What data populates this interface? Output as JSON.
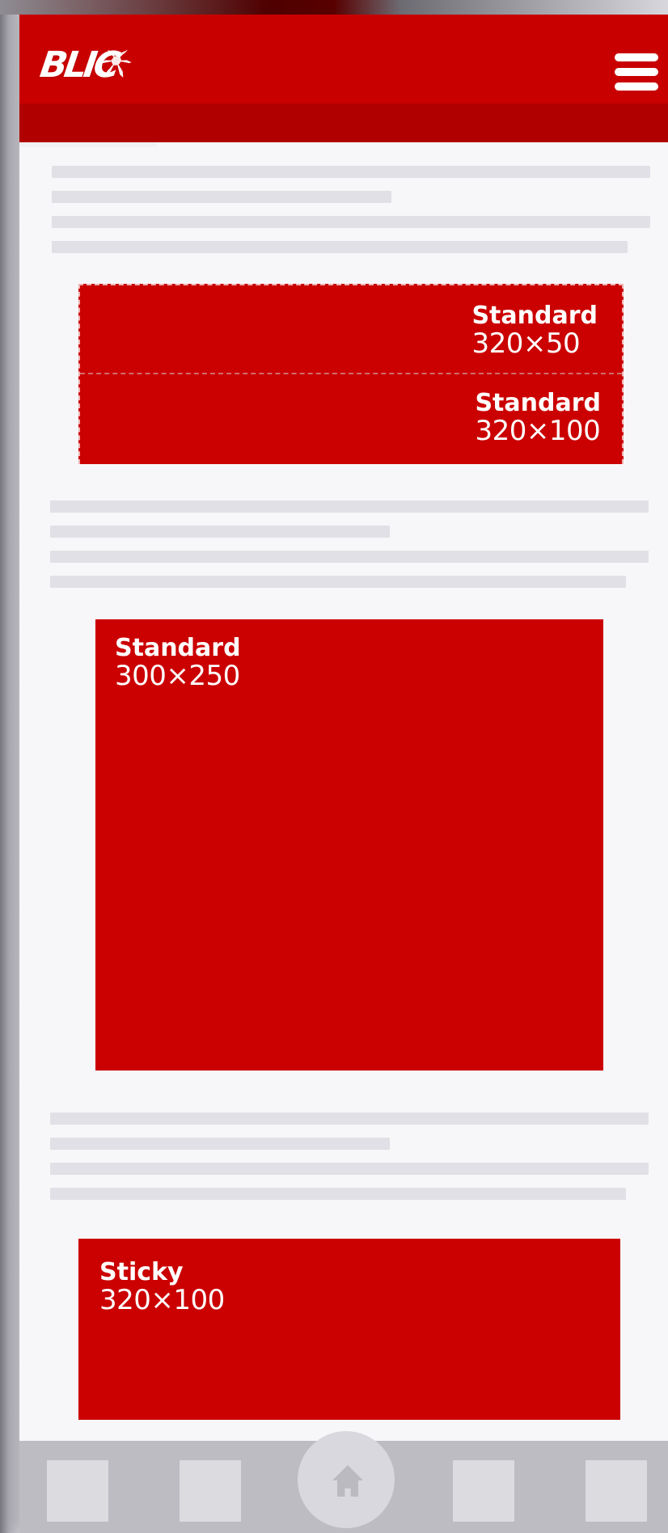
{
  "header": {
    "brand": "BLIC"
  },
  "ads": [
    {
      "type": "Standard",
      "size": "320×50"
    },
    {
      "type": "Standard",
      "size": "320×100"
    },
    {
      "type": "Standard",
      "size": "300×250"
    },
    {
      "type": "Sticky",
      "size": "320×100"
    }
  ],
  "icons": {
    "menu": "hamburger-menu-icon",
    "home": "home-icon"
  },
  "colors": {
    "header": "#c90000",
    "header_band": "#b10000",
    "ad_fill": "#cb0000",
    "skeleton": "#e1e0e6",
    "bottom_nav": "#bdbcc2"
  }
}
